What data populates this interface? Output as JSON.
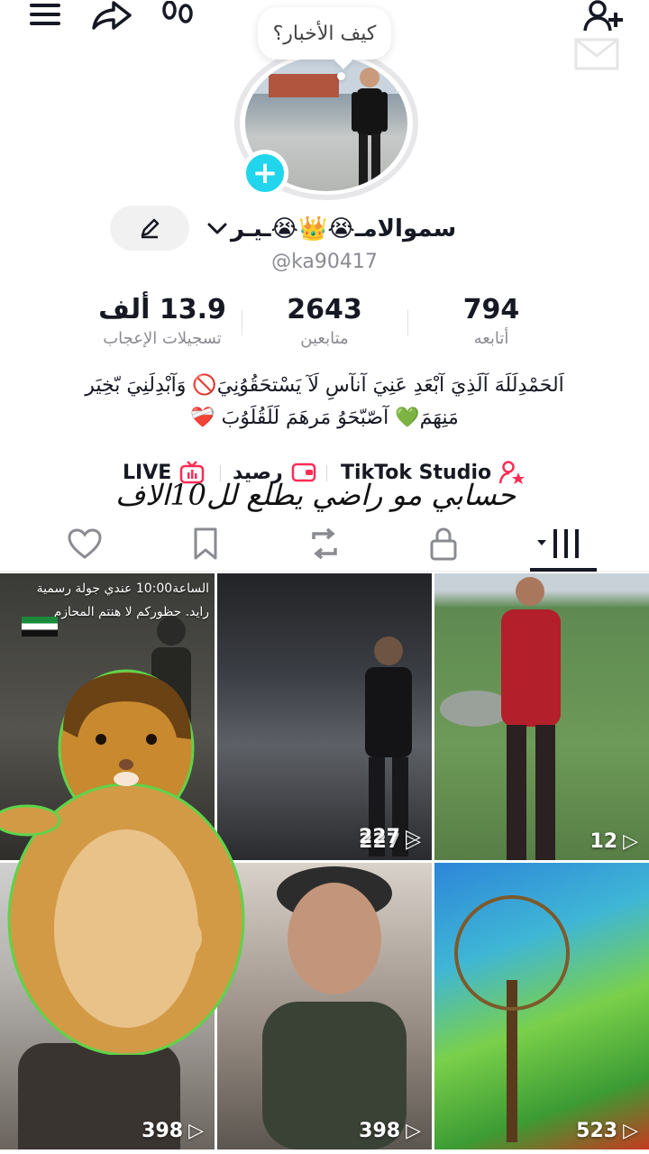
{
  "topbar": {
    "menu_icon": "menu-icon",
    "share_icon": "share-icon",
    "footprint_icon": "footprints-icon",
    "add_user_icon": "add-user-icon"
  },
  "profile": {
    "note": "كيف الأخبار؟",
    "display_name": "سموالامـ😭👑😭ـيـر",
    "username": "@ka90417"
  },
  "stats": {
    "likes_value": "13.9 ألف",
    "likes_label": "تسجيلات الإعجاب",
    "followers_value": "2643",
    "followers_label": "متابعين",
    "following_value": "794",
    "following_label": "أتابعه"
  },
  "bio": {
    "line1": "اَلحَمْدِلَلَهَ آلَذِيَ آبْعَدِ عَنِيَ آنآسِ لَآ يَسْتحَقُوُنِيَ🚫 وَآبْدِلَنِيَ بّخِيَر",
    "line2": "مَنِهَمَ💚 آصّبّحَوُ مَرهَمَ لَلَقُلَوُبَ ❤️‍🩹"
  },
  "links": {
    "studio": "TikTok Studio",
    "wallet": "رصيد",
    "live": "LIVE"
  },
  "overlay_text": "حسابي مو راضي يطلع لل10الاف",
  "tabs": [
    "videos",
    "private",
    "reposts",
    "saved",
    "liked"
  ],
  "grid": [
    {
      "views": "227",
      "caption_top": "الساعة10:00 عندي جولة رسمية رايد. حظوركم لا هنتم المحازم"
    },
    {
      "views": "227"
    },
    {
      "views": "12"
    },
    {
      "views": "398"
    },
    {
      "views": "398"
    },
    {
      "views": "523"
    }
  ],
  "colors": {
    "accent": "#20d5ec",
    "text": "#161823",
    "muted": "#8a8b91",
    "studio_icon": "#fe2c55"
  }
}
